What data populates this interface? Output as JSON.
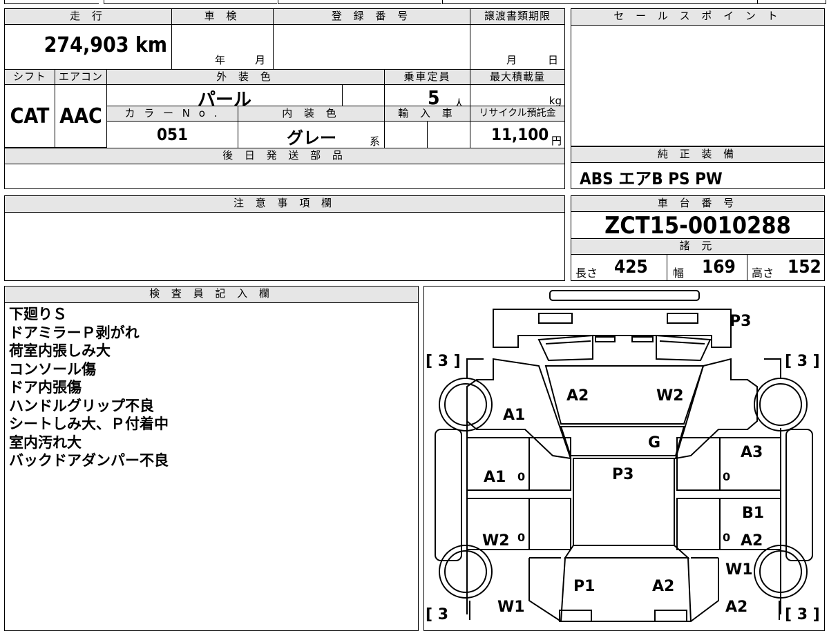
{
  "top": {
    "mileage_label": "走 行",
    "inspection_label": "車 検",
    "registration_label": "登 録 番 号",
    "transfer_deadline_label": "譲渡書類期限",
    "mileage_value": "274,903 km",
    "year_unit": "年",
    "month_unit": "月",
    "deadline_month_unit": "月",
    "deadline_day_unit": "日",
    "shift_label": "シフト",
    "ac_label": "エアコン",
    "exterior_color_label": "外 装 色",
    "capacity_label": "乗車定員",
    "max_load_label": "最大積載量",
    "shift_value": "CAT",
    "ac_value": "AAC",
    "exterior_color_value": "パール",
    "capacity_value": "5",
    "capacity_unit": "人",
    "max_load_unit": "kg",
    "color_no_label": "カ ラ ー N o .",
    "interior_color_label": "内 装 色",
    "import_label": "輸 入 車",
    "recycle_label": "リサイクル預託金",
    "color_no_value": "051",
    "interior_color_value": "グレー",
    "interior_color_suffix": "系",
    "recycle_value": "11,100",
    "recycle_unit": "円",
    "later_parts_label": "後 日 発 送 部 品"
  },
  "sales_point": {
    "label": "セ ー ル ス ポ イ ン ト"
  },
  "equipment": {
    "label": "純 正 装 備",
    "value": "ABS エアB PS PW"
  },
  "notes": {
    "label": "注 意 事 項 欄"
  },
  "chassis": {
    "label": "車 台 番 号",
    "value": "ZCT15-0010288"
  },
  "specs": {
    "label": "諸 元",
    "length_label": "長さ",
    "length_value": "425",
    "width_label": "幅",
    "width_value": "169",
    "height_label": "高さ",
    "height_value": "152"
  },
  "inspector": {
    "label": "検 査 員 記 入 欄",
    "lines": [
      "下廻りＳ",
      "ドアミラーＰ剥がれ",
      "荷室内張しみ大",
      "コンソール傷",
      "ドア内張傷",
      "ハンドルグリップ不良",
      "シートしみ大、Ｐ付着中",
      "室内汚れ大",
      "バックドアダンパー不良"
    ]
  },
  "diagram": {
    "marks": {
      "top_right": "P3",
      "bracket_tl": "[ 3 ]",
      "bracket_tr": "[ 3 ]",
      "bracket_bl": "[ 3",
      "bracket_br": "[ 3 ]",
      "hood_left": "A2",
      "hood_right": "W2",
      "fender_fl": "A1",
      "grille": "G",
      "door_fl": "A1",
      "door_fr": "A3",
      "roof": "P3",
      "pillar_r": "B1",
      "door_rl": "W2",
      "door_rr": "A2",
      "quarter_r": "W1",
      "trunk_left": "P1",
      "trunk_right": "A2",
      "rear_l": "W1",
      "rear_r": "A2",
      "zero1": "0",
      "zero2": "0",
      "zero3": "0",
      "zero4": "0"
    }
  }
}
